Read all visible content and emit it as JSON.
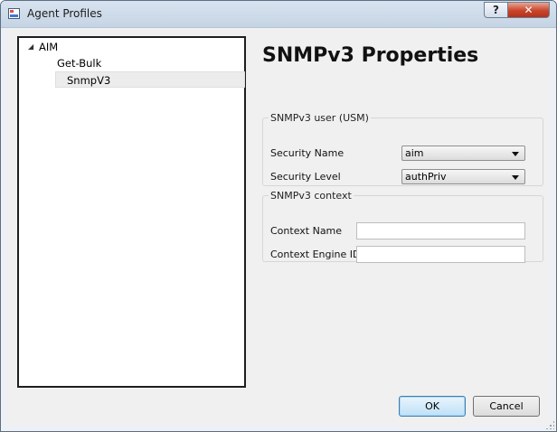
{
  "window": {
    "title": "Agent Profiles",
    "help_label": "?",
    "close_label": "✕"
  },
  "tree": {
    "root": {
      "label": "AIM",
      "expander": "◢"
    },
    "children": [
      {
        "label": "Get-Bulk"
      },
      {
        "label": "SnmpV3",
        "selected": true
      }
    ]
  },
  "heading": "SNMPv3 Properties",
  "usm_group": {
    "legend": "SNMPv3 user (USM)",
    "security_name": {
      "label": "Security Name",
      "value": "aim"
    },
    "security_level": {
      "label": "Security Level",
      "value": "authPriv"
    }
  },
  "context_group": {
    "legend": "SNMPv3 context",
    "context_name": {
      "label": "Context Name",
      "value": ""
    },
    "context_engine_id": {
      "label": "Context Engine ID",
      "value": ""
    }
  },
  "buttons": {
    "ok": "OK",
    "cancel": "Cancel"
  },
  "colors": {
    "selection_bg": "#ececec",
    "close_button": "#c9452b",
    "titlebar": "#c5d4e5"
  }
}
